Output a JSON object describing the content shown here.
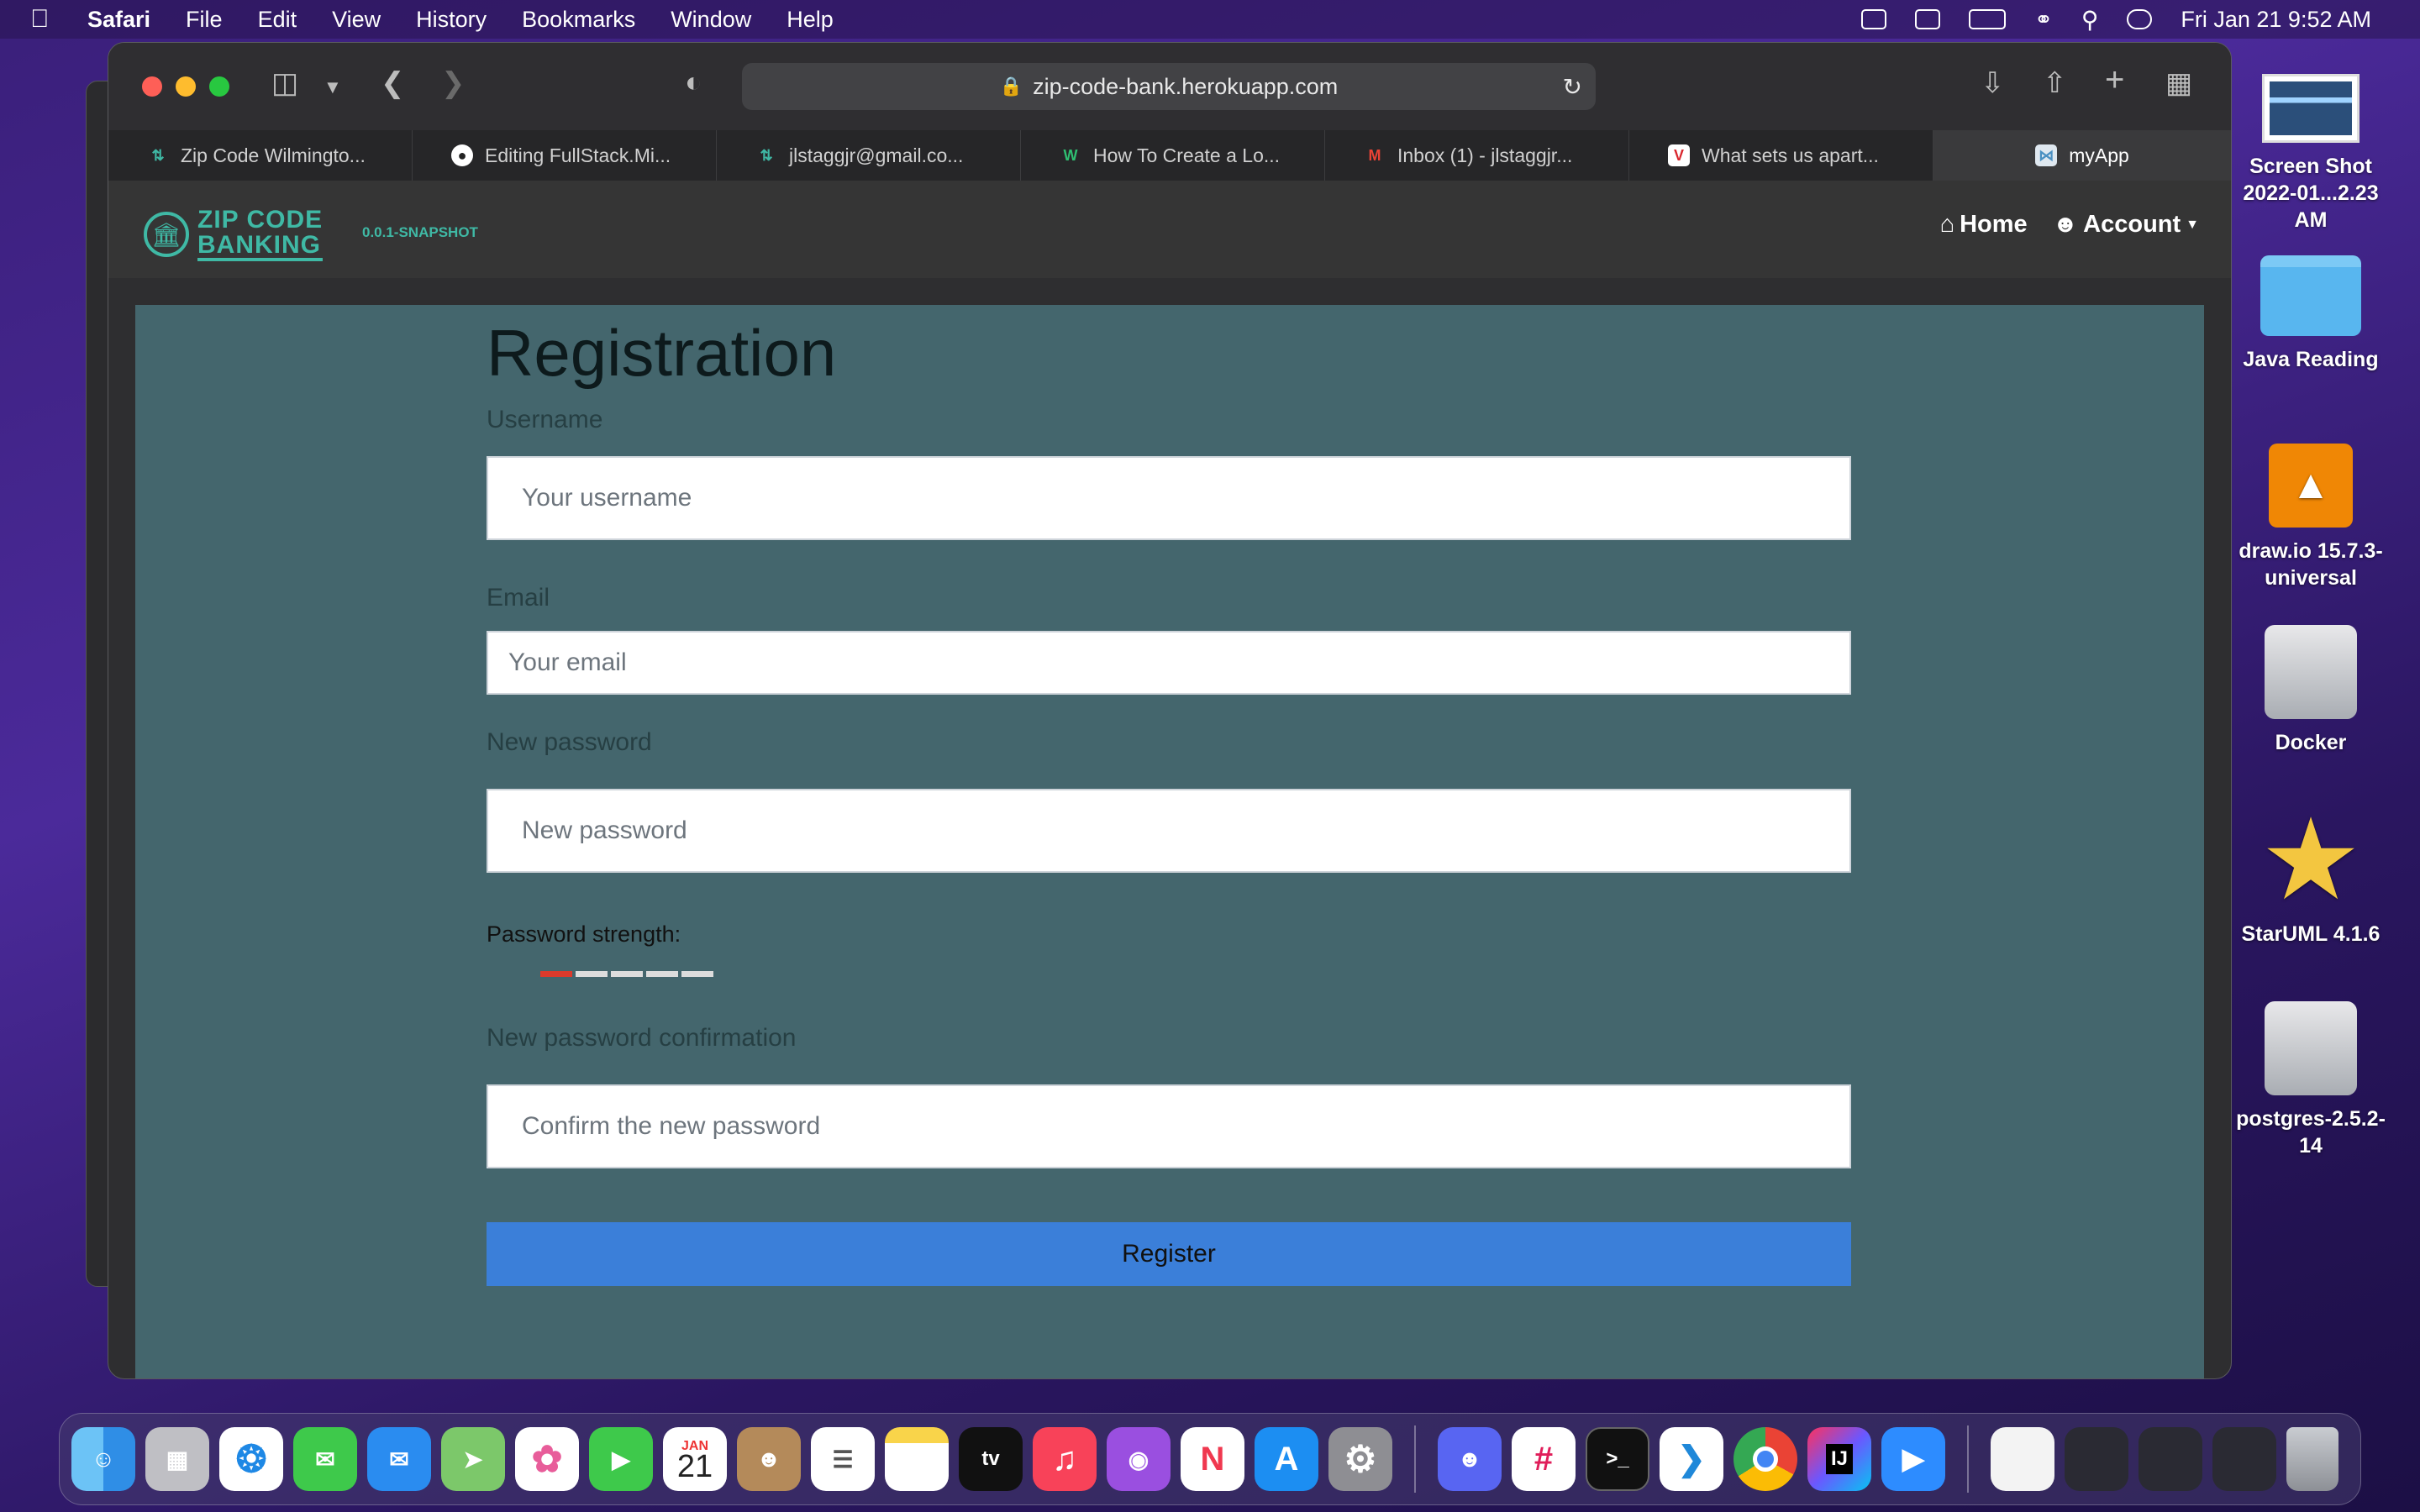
{
  "menubar": {
    "app_name": "Safari",
    "items": [
      "File",
      "Edit",
      "View",
      "History",
      "Bookmarks",
      "Window",
      "Help"
    ],
    "clock": "Fri Jan 21  9:52 AM"
  },
  "browser": {
    "url": "zip-code-bank.herokuapp.com",
    "tabs": [
      {
        "label": "Zip Code Wilmingto...",
        "icon": "zipcode-favicon",
        "color": "#3fb9a5"
      },
      {
        "label": "Editing FullStack.Mi...",
        "icon": "github-favicon",
        "color": "#ffffff"
      },
      {
        "label": "jlstaggjr@gmail.co...",
        "icon": "zipcode-favicon",
        "color": "#3fb9a5"
      },
      {
        "label": "How To Create a Lo...",
        "icon": "w-favicon",
        "color": "#2fbf71"
      },
      {
        "label": "Inbox (1) - jlstaggjr...",
        "icon": "gmail-favicon",
        "color": "#ea4335"
      },
      {
        "label": "What sets us apart...",
        "icon": "v-favicon",
        "color": "#d9272e"
      },
      {
        "label": "myApp",
        "icon": "myapp-favicon",
        "color": "#4a90c2"
      }
    ]
  },
  "app": {
    "logo_line1": "ZIP CODE",
    "logo_line2": "BANKING",
    "version": "0.0.1-SNAPSHOT",
    "nav_home": "Home",
    "nav_account": "Account",
    "accent": "#3fb9a5"
  },
  "form": {
    "title": "Registration",
    "username_label": "Username",
    "username_placeholder": "Your username",
    "email_label": "Email",
    "email_placeholder": "Your email",
    "password_label": "New password",
    "password_placeholder": "New password",
    "strength_label": "Password strength:",
    "strength_level": 1,
    "strength_max": 5,
    "confirm_label": "New password confirmation",
    "confirm_placeholder": "Confirm the new password",
    "register_label": "Register",
    "button_color": "#3b7fd9"
  },
  "desktop": {
    "icons": [
      {
        "label": "Screen Shot 2022-01...2.23 AM",
        "icon": "screenshot-icon"
      },
      {
        "label": "Java Reading",
        "icon": "folder-icon"
      },
      {
        "label": "draw.io 15.7.3-universal",
        "icon": "drawio-icon"
      },
      {
        "label": "Docker",
        "icon": "disk-icon"
      },
      {
        "label": "StarUML 4.1.6",
        "icon": "staruml-icon"
      },
      {
        "label": "postgres-2.5.2-14",
        "icon": "disk-icon"
      }
    ]
  },
  "dock": {
    "calendar_month": "JAN",
    "calendar_day": "21",
    "apps": [
      "Finder",
      "Launchpad",
      "Safari",
      "Messages",
      "Mail",
      "Maps",
      "Photos",
      "FaceTime",
      "Calendar",
      "Contacts",
      "Reminders",
      "Notes",
      "TV",
      "Music",
      "Podcasts",
      "News",
      "App Store",
      "System Preferences",
      "Discord",
      "Slack",
      "Terminal",
      "VS Code",
      "Chrome",
      "IntelliJ IDEA",
      "Zoom"
    ]
  }
}
